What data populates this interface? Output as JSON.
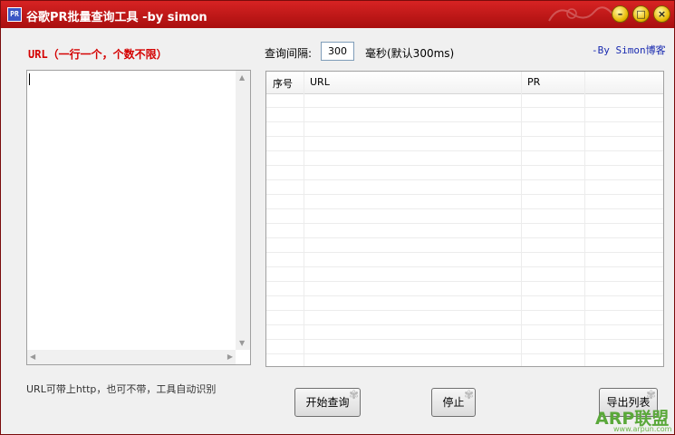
{
  "window": {
    "title": "谷歌PR批量查询工具 -by simon",
    "icon_text": "PR"
  },
  "url_panel": {
    "label": "URL（一行一个，个数不限）",
    "value": "",
    "hint": "URL可带上http，也可不带，工具自动识别"
  },
  "interval": {
    "label": "查询间隔:",
    "value": "300",
    "unit": "毫秒(默认300ms)"
  },
  "blog_link": "-By Simon博客",
  "table": {
    "columns": [
      "序号",
      "URL",
      "PR"
    ],
    "rows": []
  },
  "buttons": {
    "start": "开始查询",
    "stop": "停止",
    "export": "导出列表"
  },
  "watermark": {
    "text": "ARP联盟",
    "sub": "www.arpun.com"
  },
  "colors": {
    "titlebar": "#c41a1a",
    "label_red": "#d40000",
    "link_blue": "#1a2bb0"
  }
}
